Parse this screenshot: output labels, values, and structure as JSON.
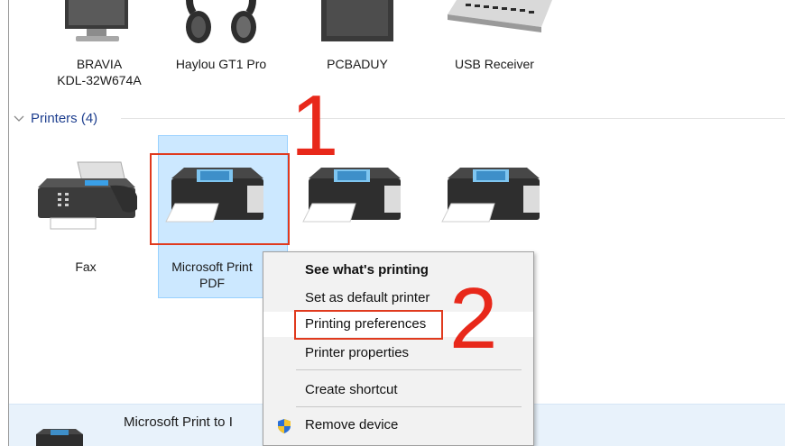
{
  "devices": [
    {
      "name": "BRAVIA",
      "name2": "KDL-32W674A"
    },
    {
      "name": "Haylou GT1 Pro"
    },
    {
      "name": "PCBADUY"
    },
    {
      "name": "USB Receiver"
    }
  ],
  "printers_group": {
    "label": "Printers (4)"
  },
  "printers": [
    {
      "name": "Fax"
    },
    {
      "name": "Microsoft Print",
      "name2": "PDF"
    }
  ],
  "context_menu": {
    "items": [
      {
        "label": "See what's printing"
      },
      {
        "label": "Set as default printer"
      },
      {
        "label": "Printing preferences"
      },
      {
        "label": "Printer properties"
      },
      {
        "label": "Create shortcut"
      },
      {
        "label": "Remove device"
      }
    ]
  },
  "annotations": {
    "step1": "1",
    "step2": "2",
    "color": "#e8281a"
  },
  "details_bar": {
    "title": "Microsoft Print to I"
  },
  "colors": {
    "selection": "#cce8ff",
    "group_header": "#1e3f8f",
    "highlight_box": "#e03a1e"
  }
}
